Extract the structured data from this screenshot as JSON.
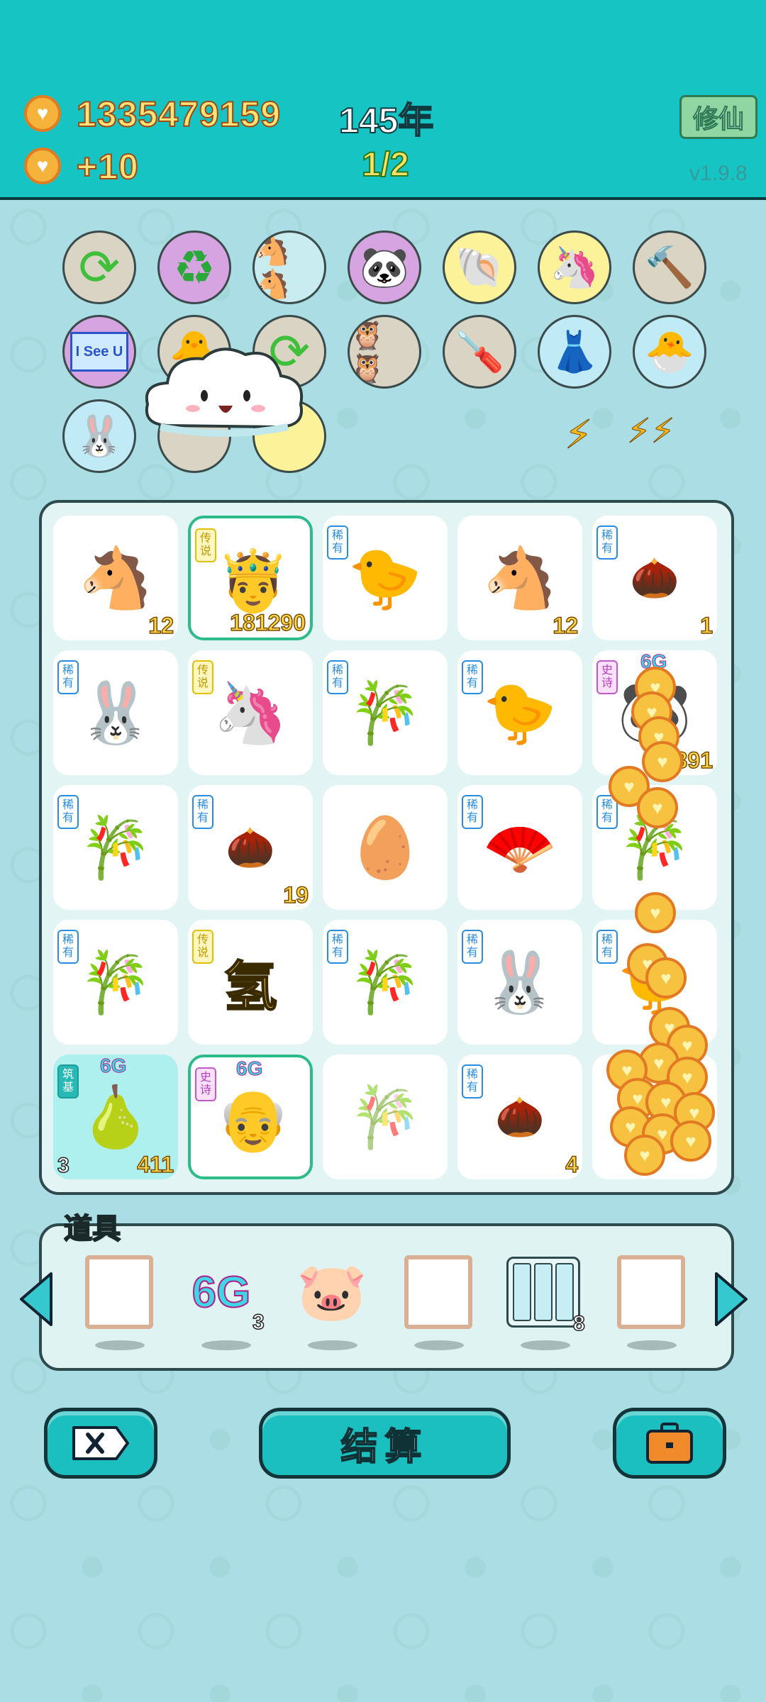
{
  "header": {
    "coins": "1335479159",
    "income": "+10",
    "year": "145年",
    "round": "1/2",
    "mode_button": "修仙",
    "version": "v1.9.8"
  },
  "symbols": {
    "row1": [
      "refresh",
      "recycle",
      "horses",
      "panda",
      "shell",
      "unicorn",
      "hammer"
    ],
    "row2": [
      "i-see-u-card",
      "chick",
      "refresh",
      "owls",
      "screwdriver",
      "skirt",
      "chick-egg"
    ],
    "row3": [
      "rabbit"
    ],
    "i_see_u_label": "I See U"
  },
  "board": {
    "cells": [
      {
        "rarity": "",
        "icon": "horse",
        "count": "12"
      },
      {
        "rarity": "传说",
        "icon": "king-old-man",
        "count": "181290",
        "selected": true
      },
      {
        "rarity": "稀有",
        "icon": "chick",
        "count": ""
      },
      {
        "rarity": "",
        "icon": "horse",
        "count": "12"
      },
      {
        "rarity": "稀有",
        "icon": "nut",
        "count": "1"
      },
      {
        "rarity": "稀有",
        "icon": "rabbit-book",
        "count": ""
      },
      {
        "rarity": "传说",
        "icon": "unicorn",
        "count": ""
      },
      {
        "rarity": "稀有",
        "icon": "bamboo",
        "count": ""
      },
      {
        "rarity": "稀有",
        "icon": "chick",
        "count": ""
      },
      {
        "rarity": "史诗",
        "icon": "panda-king",
        "count": "391",
        "tag": "6G"
      },
      {
        "rarity": "稀有",
        "icon": "bamboo",
        "count": ""
      },
      {
        "rarity": "稀有",
        "icon": "nut",
        "count": "19"
      },
      {
        "rarity": "",
        "icon": "egg",
        "count": ""
      },
      {
        "rarity": "稀有",
        "icon": "fan",
        "count": ""
      },
      {
        "rarity": "稀有",
        "icon": "bamboo",
        "count": ""
      },
      {
        "rarity": "稀有",
        "icon": "bamboo",
        "count": ""
      },
      {
        "rarity": "传说",
        "icon": "hydrogen-char",
        "count": "",
        "char": "氢"
      },
      {
        "rarity": "稀有",
        "icon": "bamboo",
        "count": ""
      },
      {
        "rarity": "稀有",
        "icon": "rabbit-book",
        "count": ""
      },
      {
        "rarity": "稀有",
        "icon": "chick",
        "count": ""
      },
      {
        "rarity": "筑基",
        "icon": "fruits",
        "count": "411",
        "left_count": "3",
        "tag": "6G"
      },
      {
        "rarity": "史诗",
        "icon": "grumpy-king",
        "count": "",
        "tag": "6G",
        "selected": true
      },
      {
        "rarity": "",
        "icon": "bamboo",
        "count": ""
      },
      {
        "rarity": "稀有",
        "icon": "nut",
        "count": "4"
      },
      {
        "rarity": "",
        "icon": "bamboo",
        "count": ""
      }
    ]
  },
  "items": {
    "label": "道具",
    "slots": [
      {
        "icon": "empty-frame",
        "count": ""
      },
      {
        "icon": "6g",
        "label": "6G",
        "count": "3"
      },
      {
        "icon": "piggy-bank",
        "count": ""
      },
      {
        "icon": "empty-frame",
        "count": ""
      },
      {
        "icon": "epic-cards",
        "count": "8"
      },
      {
        "icon": "empty-frame",
        "count": ""
      }
    ]
  },
  "buttons": {
    "delete": "delete",
    "settle": "结算",
    "bag": "briefcase"
  },
  "colors": {
    "header": "#16c4c4",
    "board_bg": "#e2f5f4",
    "coin": "#f6b33c",
    "accent": "#1bbfbf"
  }
}
